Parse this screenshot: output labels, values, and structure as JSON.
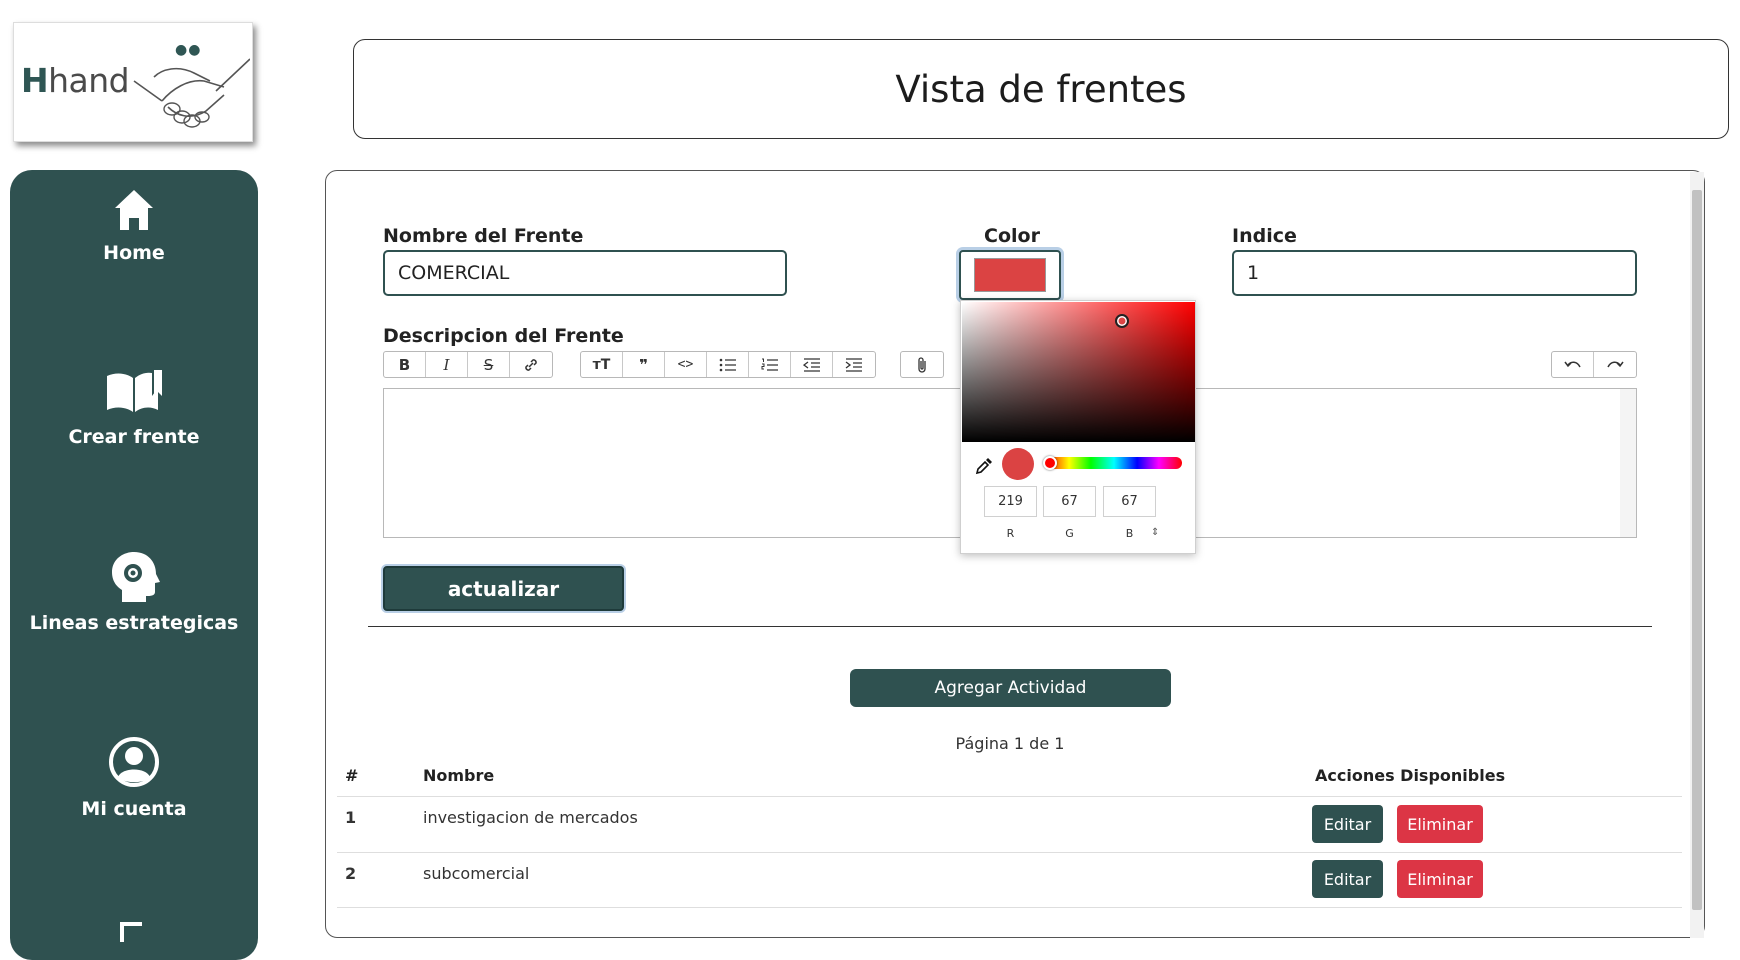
{
  "logo": {
    "brand_h": "H",
    "brand_rest": "hand"
  },
  "sidebar": {
    "items": [
      {
        "label": "Home",
        "icon": "home-icon"
      },
      {
        "label": "Crear frente",
        "icon": "open-book-icon"
      },
      {
        "label": "Lineas estrategicas",
        "icon": "head-gear-icon"
      },
      {
        "label": "Mi cuenta",
        "icon": "user-circle-icon"
      }
    ]
  },
  "header": {
    "title": "Vista de frentes"
  },
  "form": {
    "name_label": "Nombre del Frente",
    "name_value": "COMERCIAL",
    "color_label": "Color",
    "color_value": "#db4343",
    "index_label": "Indice",
    "index_value": "1",
    "description_label": "Descripcion del Frente",
    "description_value": "",
    "update_label": "actualizar"
  },
  "toolbar": {
    "groups": [
      [
        "bold",
        "italic",
        "strikethrough",
        "link"
      ],
      [
        "heading",
        "quote",
        "code",
        "bullet-list",
        "numbered-list",
        "outdent",
        "indent"
      ],
      [
        "attach"
      ],
      [
        "undo",
        "redo"
      ]
    ]
  },
  "color_picker": {
    "r": "219",
    "g": "67",
    "b": "67",
    "r_label": "R",
    "g_label": "G",
    "b_label": "B",
    "mode_toggle": "⇕"
  },
  "activities": {
    "add_label": "Agregar Actividad",
    "pagination": "Página 1 de 1",
    "columns": {
      "num": "#",
      "name": "Nombre",
      "actions": "Acciones Disponibles"
    },
    "rows": [
      {
        "num": "1",
        "name": "investigacion de mercados",
        "edit": "Editar",
        "delete": "Eliminar"
      },
      {
        "num": "2",
        "name": "subcomercial",
        "edit": "Editar",
        "delete": "Eliminar"
      }
    ]
  },
  "colors": {
    "primary": "#2f5150",
    "danger": "#dc3545",
    "accent_focus": "#b9cfe6"
  }
}
